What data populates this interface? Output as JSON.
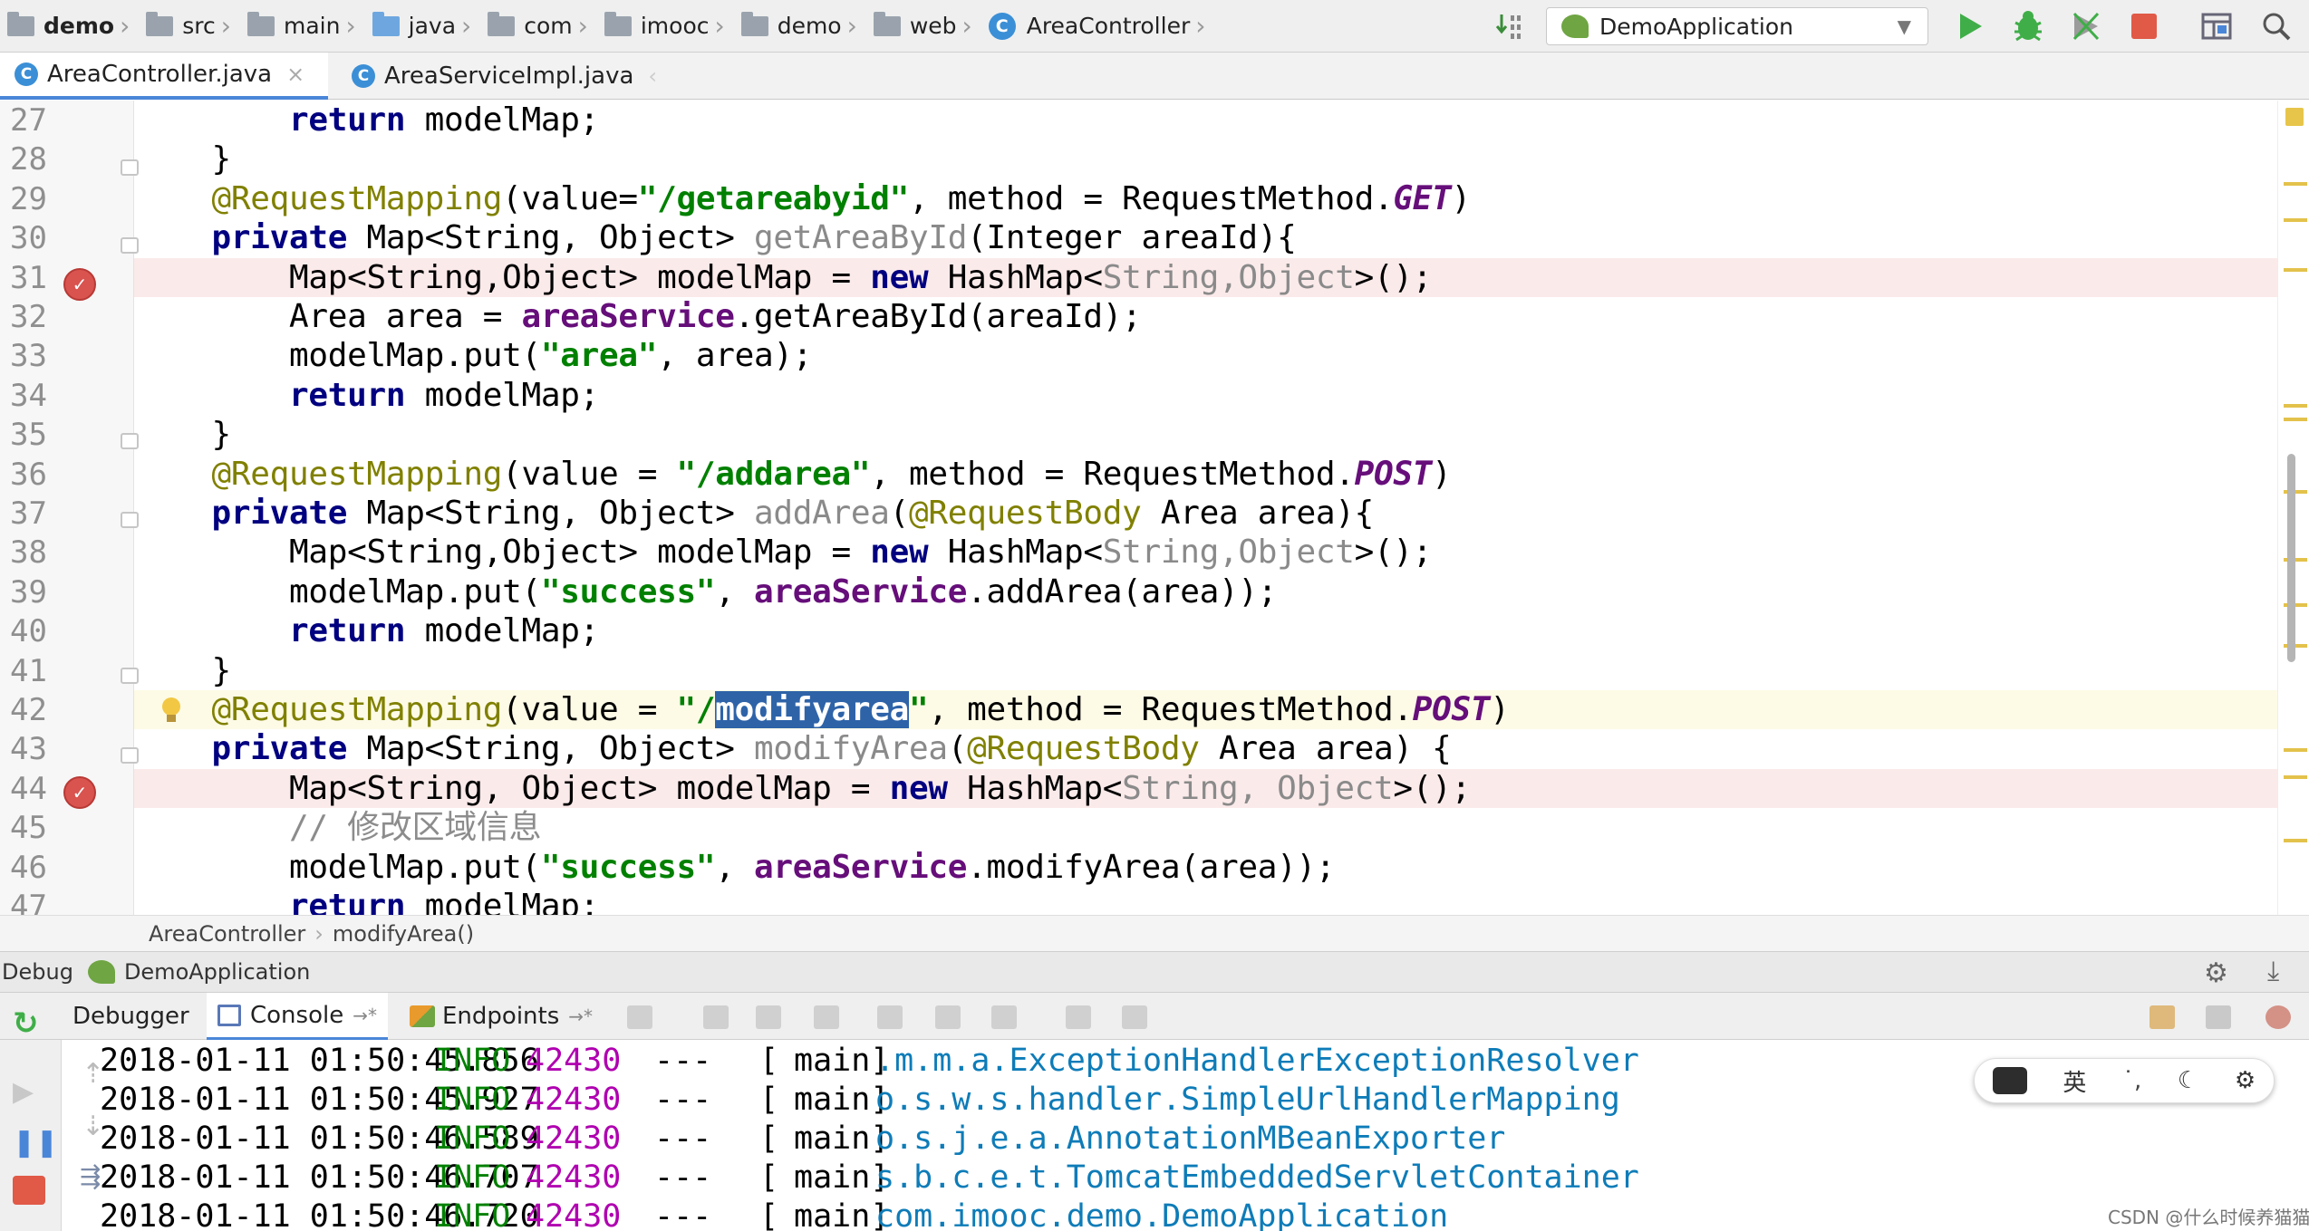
{
  "navbar": {
    "breadcrumbs": [
      "demo",
      "src",
      "main",
      "java",
      "com",
      "imooc",
      "demo",
      "web",
      "AreaController"
    ],
    "run_config": "DemoApplication"
  },
  "tabs": [
    {
      "label": "AreaController.java",
      "active": true
    },
    {
      "label": "AreaServiceImpl.java",
      "active": false
    }
  ],
  "editor": {
    "line_numbers": [
      "27",
      "28",
      "29",
      "30",
      "31",
      "32",
      "33",
      "34",
      "35",
      "36",
      "37",
      "38",
      "39",
      "40",
      "41",
      "42",
      "43",
      "44",
      "45",
      "46",
      "47"
    ],
    "code": {
      "l27": {
        "i": "        ",
        "kw": "return",
        "rest": " modelMap;"
      },
      "l28": "    }",
      "l29": {
        "i": "    ",
        "an": "@RequestMapping",
        "a": "(value=",
        "s": "\"/getareabyid\"",
        "b": ", method = RequestMethod.",
        "e": "GET",
        "c": ")"
      },
      "l30": {
        "i": "    ",
        "kw": "private",
        "a": " Map<String, Object> ",
        "m": "getAreaById",
        "b": "(Integer areaId){"
      },
      "l31": {
        "i": "        ",
        "a": "Map<String,Object> modelMap = ",
        "kw": "new",
        "b": " HashMap<",
        "g": "String,Object",
        "c": ">();"
      },
      "l32": {
        "i": "        ",
        "a": "Area area = ",
        "f": "areaService",
        "b": ".getAreaById(areaId);"
      },
      "l33": {
        "i": "        ",
        "a": "modelMap.put(",
        "s": "\"area\"",
        "b": ", area);"
      },
      "l34": {
        "i": "        ",
        "kw": "return",
        "rest": " modelMap;"
      },
      "l35": "    }",
      "l36": {
        "i": "    ",
        "an": "@RequestMapping",
        "a": "(value = ",
        "s": "\"/addarea\"",
        "b": ", method = RequestMethod.",
        "e": "POST",
        "c": ")"
      },
      "l37": {
        "i": "    ",
        "kw": "private",
        "a": " Map<String, Object> ",
        "m": "addArea",
        "p": "(",
        "an2": "@RequestBody",
        "b": " Area area){"
      },
      "l38": {
        "i": "        ",
        "a": "Map<String,Object> modelMap = ",
        "kw": "new",
        "b": " HashMap<",
        "g": "String,Object",
        "c": ">();"
      },
      "l39": {
        "i": "        ",
        "a": "modelMap.put(",
        "s": "\"success\"",
        "p": ", ",
        "f": "areaService",
        "b": ".addArea(area));"
      },
      "l40": {
        "i": "        ",
        "kw": "return",
        "rest": " modelMap;"
      },
      "l41": "    }",
      "l42": {
        "i": "    ",
        "an": "@RequestMapping",
        "a": "(value = ",
        "s1": "\"/",
        "sel": "modifyarea",
        "s2": "\"",
        "b": ", method = RequestMethod.",
        "e": "POST",
        "c": ")"
      },
      "l43": {
        "i": "    ",
        "kw": "private",
        "a": " Map<String, Object> ",
        "m": "modifyArea",
        "p": "(",
        "an2": "@RequestBody",
        "b": " Area area) {"
      },
      "l44": {
        "i": "        ",
        "a": "Map<String, Object> modelMap = ",
        "kw": "new",
        "b": " HashMap<",
        "g": "String, Object",
        "c": ">();"
      },
      "l45": {
        "i": "        ",
        "cm": "// 修改区域信息"
      },
      "l46": {
        "i": "        ",
        "a": "modelMap.put(",
        "s": "\"success\"",
        "p": ", ",
        "f": "areaService",
        "b": ".modifyArea(area));"
      },
      "l47": {
        "i": "        ",
        "kw": "return",
        "rest": " modelMap;"
      }
    }
  },
  "code_breadcrumb": {
    "class": "AreaController",
    "method": "modifyArea()"
  },
  "debug": {
    "label": "Debug",
    "app": "DemoApplication",
    "tabs": [
      "Debugger",
      "Console",
      "Endpoints"
    ]
  },
  "console_rows": [
    {
      "ts": "2018-01-11 01:50:45.856",
      "level": "INFO",
      "pid": "42430",
      "sep": "---",
      "bracket": "[",
      "thread": "main]",
      "logger": ".m.m.a.ExceptionHandlerExceptionResolver"
    },
    {
      "ts": "2018-01-11 01:50:45.927",
      "level": "INFO",
      "pid": "42430",
      "sep": "---",
      "bracket": "[",
      "thread": "main]",
      "logger": "o.s.w.s.handler.SimpleUrlHandlerMapping"
    },
    {
      "ts": "2018-01-11 01:50:46.589",
      "level": "INFO",
      "pid": "42430",
      "sep": "---",
      "bracket": "[",
      "thread": "main]",
      "logger": "o.s.j.e.a.AnnotationMBeanExporter"
    },
    {
      "ts": "2018-01-11 01:50:46.707",
      "level": "INFO",
      "pid": "42430",
      "sep": "---",
      "bracket": "[",
      "thread": "main]",
      "logger": "s.b.c.e.t.TomcatEmbeddedServletContainer"
    },
    {
      "ts": "2018-01-11 01:50:46.720",
      "level": "INFO",
      "pid": "42430",
      "sep": "---",
      "bracket": "[",
      "thread": "main]",
      "logger": "com.imooc.demo.DemoApplication"
    }
  ],
  "ime": {
    "label": "英"
  },
  "watermark": "CSDN @什么时候养猫猫"
}
